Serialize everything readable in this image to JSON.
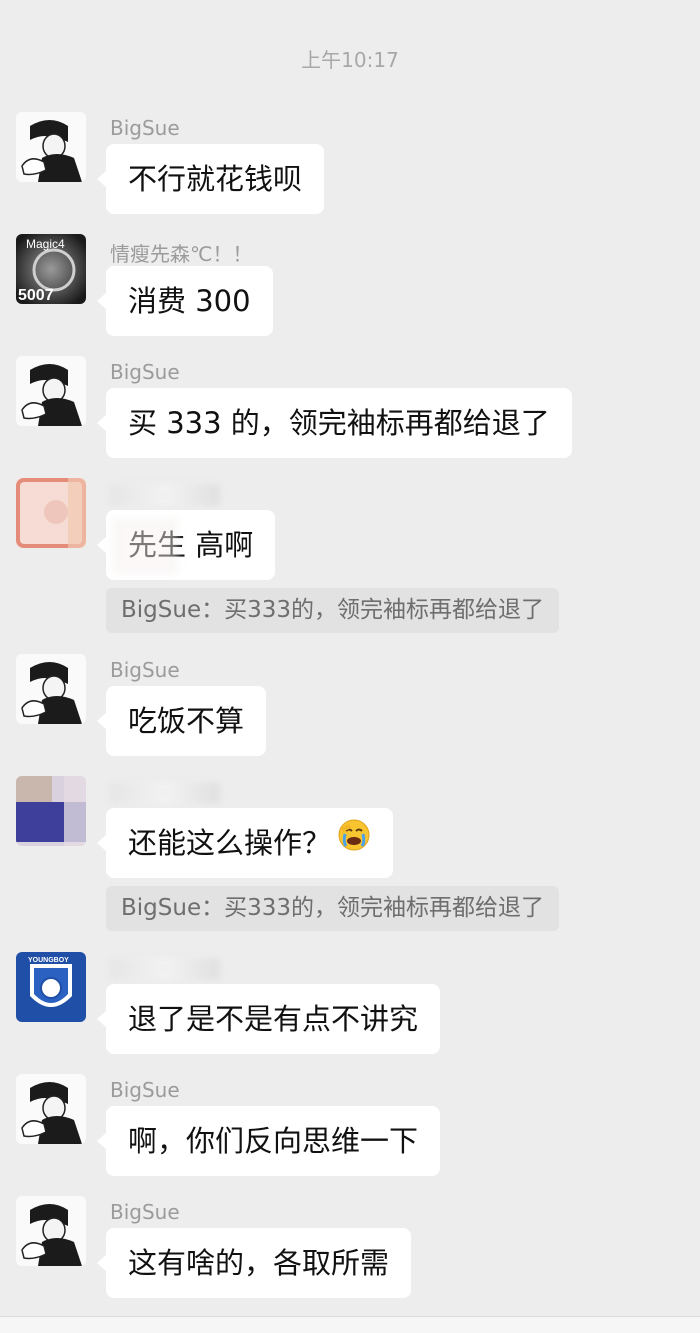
{
  "timestamp": "上午10:17",
  "messages": [
    {
      "sender": "BigSue",
      "text": "不行就花钱呗"
    },
    {
      "sender": "情瘦先森℃！！",
      "text": "消费 300",
      "avatar_text": "Magic4",
      "avatar_sub": "5007"
    },
    {
      "sender": "BigSue",
      "text": "买 333 的，领完袖标再都给退了"
    },
    {
      "sender": "",
      "text": "先生 高啊",
      "quote": "BigSue：买333的，领完袖标再都给退了"
    },
    {
      "sender": "BigSue",
      "text": "吃饭不算"
    },
    {
      "sender": "",
      "text": "还能这么操作？",
      "emoji": "facepalm-crying",
      "quote": "BigSue：买333的，领完袖标再都给退了"
    },
    {
      "sender": "",
      "text": "退了是不是有点不讲究",
      "avatar_text": "YOUNGBOY"
    },
    {
      "sender": "BigSue",
      "text": "啊，你们反向思维一下"
    },
    {
      "sender": "BigSue",
      "text": "这有啥的，各取所需"
    }
  ],
  "colors": {
    "background": "#ededed",
    "bubble": "#ffffff",
    "quote_bg": "#e2e2e2",
    "sender": "#9b9b9b"
  }
}
